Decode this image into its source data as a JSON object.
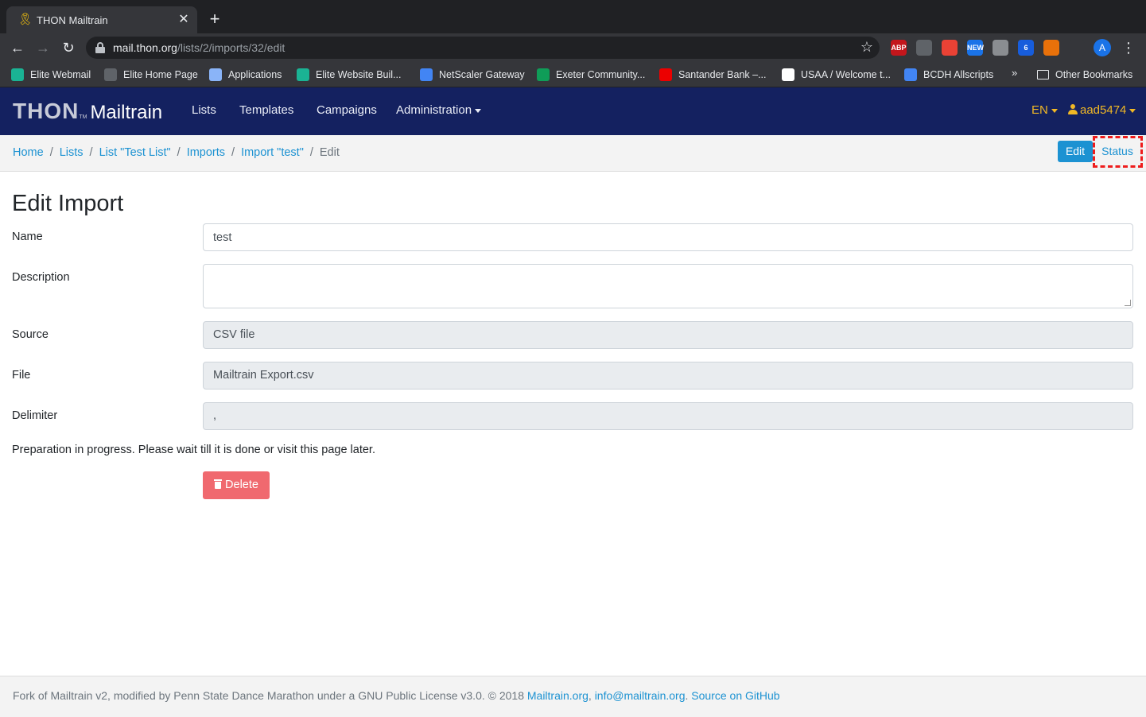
{
  "browser": {
    "tab_title": "THON Mailtrain",
    "url_host": "mail.thon.org",
    "url_path": "/lists/2/imports/32/edit",
    "avatar_letter": "A",
    "extensions": [
      {
        "name": "adblock-icon",
        "label": "ABP",
        "color": "#c4161c"
      },
      {
        "name": "shield-extension-icon",
        "label": "",
        "color": "#5f6368"
      },
      {
        "name": "color-picker-icon",
        "label": "",
        "color": "#e94235"
      },
      {
        "name": "new-badge-extension-icon",
        "label": "NEW",
        "color": "#1a73e8"
      },
      {
        "name": "gear-extension-icon",
        "label": "",
        "color": "#8a8d91"
      },
      {
        "name": "bitwarden-icon",
        "label": "6",
        "color": "#175ddc"
      },
      {
        "name": "basketball-extension-icon",
        "label": "",
        "color": "#e8710a"
      },
      {
        "name": "puzzle-icon",
        "label": "",
        "color": "#35363a"
      }
    ],
    "bookmarks": [
      {
        "name": "bookmark-elite-webmail",
        "label": "Elite Webmail",
        "color": "#1ab394"
      },
      {
        "name": "bookmark-elite-home-page",
        "label": "Elite Home Page",
        "color": "#5f6368"
      },
      {
        "name": "bookmark-applications",
        "label": "Applications",
        "color": "#8ab4f8"
      },
      {
        "name": "bookmark-elite-website-builder",
        "label": "Elite Website Buil...",
        "color": "#1ab394"
      },
      {
        "name": "bookmark-netscaler-gateway",
        "label": "NetScaler Gateway",
        "color": "#4285f4"
      },
      {
        "name": "bookmark-exeter-community",
        "label": "Exeter Community...",
        "color": "#0f9d58"
      },
      {
        "name": "bookmark-santander-bank",
        "label": "Santander Bank –...",
        "color": "#ec0000"
      },
      {
        "name": "bookmark-usaa",
        "label": "USAA / Welcome t...",
        "color": "#ffffff"
      },
      {
        "name": "bookmark-bcdh-allscripts",
        "label": "BCDH Allscripts",
        "color": "#4285f4"
      }
    ],
    "bookmarks_more": "»",
    "other_bookmarks": "Other Bookmarks"
  },
  "navbar": {
    "brand_thon": "THON",
    "brand_tm": "TM",
    "brand_mailtrain": "Mailtrain",
    "links": {
      "lists": "Lists",
      "templates": "Templates",
      "campaigns": "Campaigns",
      "administration": "Administration"
    },
    "language": "EN",
    "user": "aad5474"
  },
  "breadcrumb": {
    "home": "Home",
    "lists": "Lists",
    "list": "List \"Test List\"",
    "imports": "Imports",
    "import": "Import \"test\"",
    "current": "Edit",
    "separator": "/"
  },
  "actions": {
    "edit": "Edit",
    "status": "Status"
  },
  "form": {
    "title": "Edit Import",
    "name_label": "Name",
    "name_value": "test",
    "description_label": "Description",
    "description_value": "",
    "source_label": "Source",
    "source_value": "CSV file",
    "file_label": "File",
    "file_value": "Mailtrain Export.csv",
    "delimiter_label": "Delimiter",
    "delimiter_value": ",",
    "progress_message": "Preparation in progress. Please wait till it is done or visit this page later.",
    "delete_label": "Delete"
  },
  "footer": {
    "text": "Fork of Mailtrain v2, modified by Penn State Dance Marathon under a GNU Public License v3.0. © 2018",
    "link_mailtrain": "Mailtrain.org",
    "comma": ",",
    "link_email": "info@mailtrain.org",
    "period": ".",
    "link_github": "Source on GitHub"
  },
  "colors": {
    "navbar_bg": "#142160",
    "accent_link": "#1c92d2",
    "user_gold": "#f1b825",
    "delete_red": "#f0696f",
    "highlight_red": "#ee1c1c"
  }
}
